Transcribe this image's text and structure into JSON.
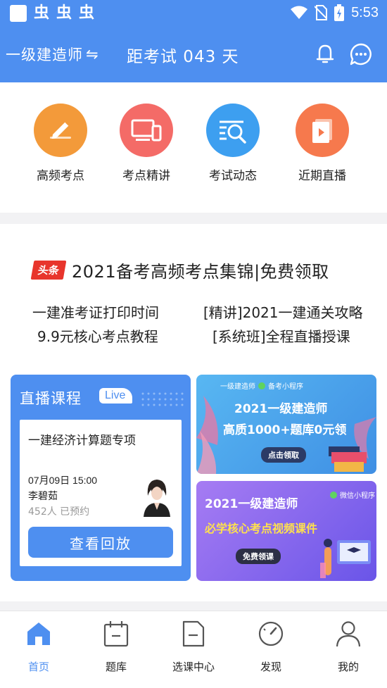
{
  "status_bar": {
    "glyphs": [
      "虫",
      "虫",
      "虫"
    ],
    "time": "5:53"
  },
  "header": {
    "subject": "一级建造师",
    "switch_glyph": "⇋",
    "countdown": "距考试 043 天",
    "bell_icon": "bell-icon",
    "chat_icon": "chat-icon"
  },
  "quick_nav": [
    {
      "label": "高频考点",
      "icon": "pencil-icon",
      "color": "#f39a3a"
    },
    {
      "label": "考点精讲",
      "icon": "devices-icon",
      "color": "#f46b67"
    },
    {
      "label": "考试动态",
      "icon": "search-list-icon",
      "color": "#3d9ff0"
    },
    {
      "label": "近期直播",
      "icon": "video-icon",
      "color": "#f6794d"
    }
  ],
  "headlines": {
    "badge": "头条",
    "title": "2021备考高频考点集锦|免费领取",
    "links": [
      "一建准考证打印时间",
      "[精讲]2021一建通关攻略",
      "9.9元核心考点教程",
      "[系统班]全程直播授课"
    ]
  },
  "live": {
    "title": "直播课程",
    "badge": "Live",
    "course": "一建经济计算题专项",
    "time": "07月09日 15:00",
    "teacher": "李碧茹",
    "booked": "452人 已预约",
    "button": "查看回放"
  },
  "banner1": {
    "brand": "一级建造师",
    "tag": "备考小程序",
    "line1": "2021一级建造师",
    "line2": "高质1000+题库0元领",
    "button": "点击领取"
  },
  "banner2": {
    "line1": "2021一级建造师",
    "tag": "微信小程序",
    "line2": "必学核心考点视频课件",
    "button": "免费领课"
  },
  "bottom_nav": [
    {
      "label": "首页",
      "icon": "home-icon",
      "active": true
    },
    {
      "label": "题库",
      "icon": "calendar-icon",
      "active": false
    },
    {
      "label": "选课中心",
      "icon": "document-icon",
      "active": false
    },
    {
      "label": "发现",
      "icon": "compass-icon",
      "active": false
    },
    {
      "label": "我的",
      "icon": "user-icon",
      "active": false
    }
  ],
  "colors": {
    "primary": "#4e8ff0",
    "badge_red": "#e8352c"
  }
}
